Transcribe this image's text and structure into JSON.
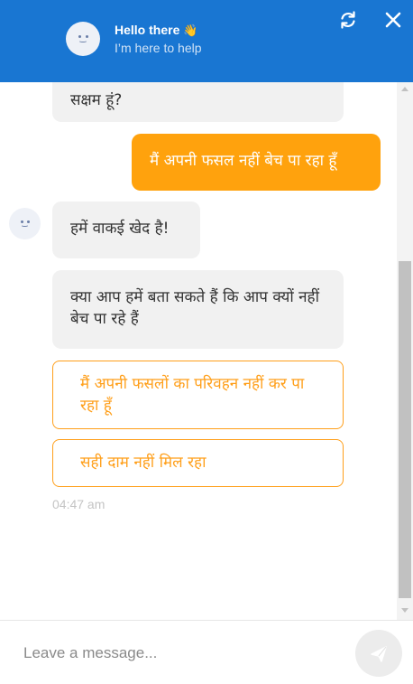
{
  "header": {
    "title": "Hello there",
    "title_emoji": "👋",
    "subtitle": "I’m here to help",
    "refresh_icon": "refresh-icon",
    "close_icon": "close-icon",
    "background_color": "#1976d2"
  },
  "messages": {
    "partial_bot_message": "सक्षम हूं?",
    "user_message": "मैं अपनी फसल नहीं बेच पा रहा हूँ",
    "bot_message_1": "हमें वाकई खेद है!",
    "bot_message_2": "क्या आप हमें बता सकते हैं कि आप क्यों नहीं बेच पा रहे हैं",
    "options": [
      {
        "label": "मैं अपनी फसलों का परिवहन नहीं कर पा रहा हूँ"
      },
      {
        "label": "सही दाम नहीं मिल रहा"
      }
    ],
    "timestamp": "04:47 am",
    "user_bubble_color": "#ffa20d",
    "option_color": "#ff9f1a"
  },
  "composer": {
    "placeholder": "Leave a message...",
    "send_icon": "send-icon"
  }
}
